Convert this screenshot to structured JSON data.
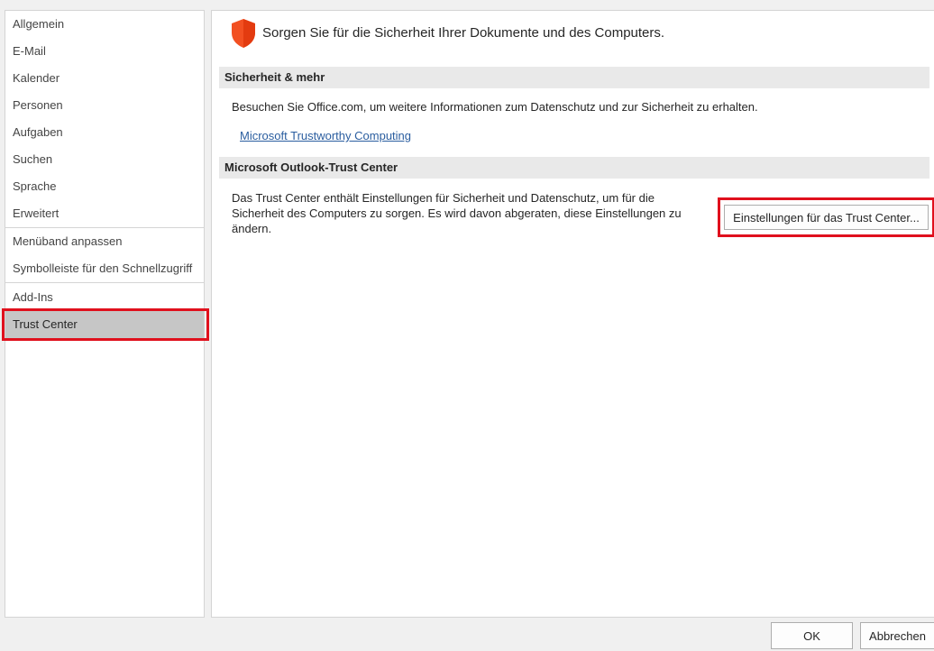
{
  "sidebar": {
    "items": [
      {
        "label": "Allgemein"
      },
      {
        "label": "E-Mail"
      },
      {
        "label": "Kalender"
      },
      {
        "label": "Personen"
      },
      {
        "label": "Aufgaben"
      },
      {
        "label": "Suchen"
      },
      {
        "label": "Sprache"
      },
      {
        "label": "Erweitert"
      },
      {
        "label": "Menüband anpassen"
      },
      {
        "label": "Symbolleiste für den Schnellzugriff"
      },
      {
        "label": "Add-Ins"
      },
      {
        "label": "Trust Center"
      }
    ],
    "selected": "Trust Center"
  },
  "main": {
    "title": "Sorgen Sie für die Sicherheit Ihrer Dokumente und des Computers.",
    "title_icon": "shield-icon",
    "sections": [
      {
        "header": "Sicherheit & mehr",
        "description": "Besuchen Sie Office.com, um weitere Informationen zum Datenschutz und zur Sicherheit zu erhalten.",
        "link": "Microsoft Trustworthy Computing"
      },
      {
        "header": "Microsoft Outlook-Trust Center",
        "description": "Das Trust Center enthält Einstellungen für Sicherheit und Datenschutz, um für die Sicherheit des Computers zu sorgen. Es wird davon abgeraten, diese Einstellungen zu ändern.",
        "button": "Einstellungen für das Trust Center..."
      }
    ]
  },
  "footer": {
    "ok_label": "OK",
    "cancel_label": "Abbrechen"
  },
  "colors": {
    "highlight": "#e0101d",
    "shield": "#f25022",
    "link": "#2a5d9f",
    "selected_bg": "#c6c6c6",
    "section_bg": "#e9e9e9"
  }
}
